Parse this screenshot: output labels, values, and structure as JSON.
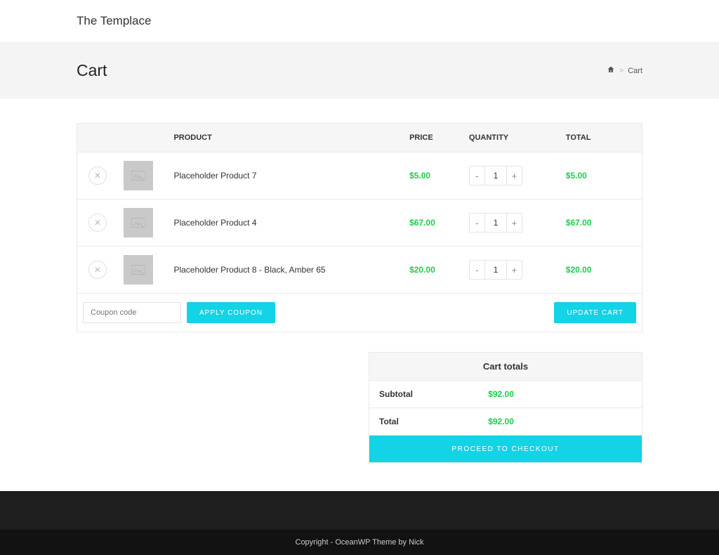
{
  "site": {
    "title": "The Templace"
  },
  "page": {
    "title": "Cart",
    "breadcrumb_current": "Cart"
  },
  "cart": {
    "headers": {
      "product": "PRODUCT",
      "price": "PRICE",
      "quantity": "QUANTITY",
      "total": "TOTAL"
    },
    "items": [
      {
        "name": "Placeholder Product 7",
        "price": "$5.00",
        "qty": "1",
        "total": "$5.00"
      },
      {
        "name": "Placeholder Product 4",
        "price": "$67.00",
        "qty": "1",
        "total": "$67.00"
      },
      {
        "name": "Placeholder Product 8 - Black, Amber 65",
        "price": "$20.00",
        "qty": "1",
        "total": "$20.00"
      }
    ],
    "coupon_placeholder": "Coupon code",
    "apply_coupon_label": "APPLY COUPON",
    "update_cart_label": "UPDATE CART"
  },
  "totals": {
    "heading": "Cart totals",
    "subtotal_label": "Subtotal",
    "subtotal_value": "$92.00",
    "total_label": "Total",
    "total_value": "$92.00",
    "checkout_label": "PROCEED TO CHECKOUT"
  },
  "footer": {
    "copyright": "Copyright - OceanWP Theme by Nick"
  }
}
